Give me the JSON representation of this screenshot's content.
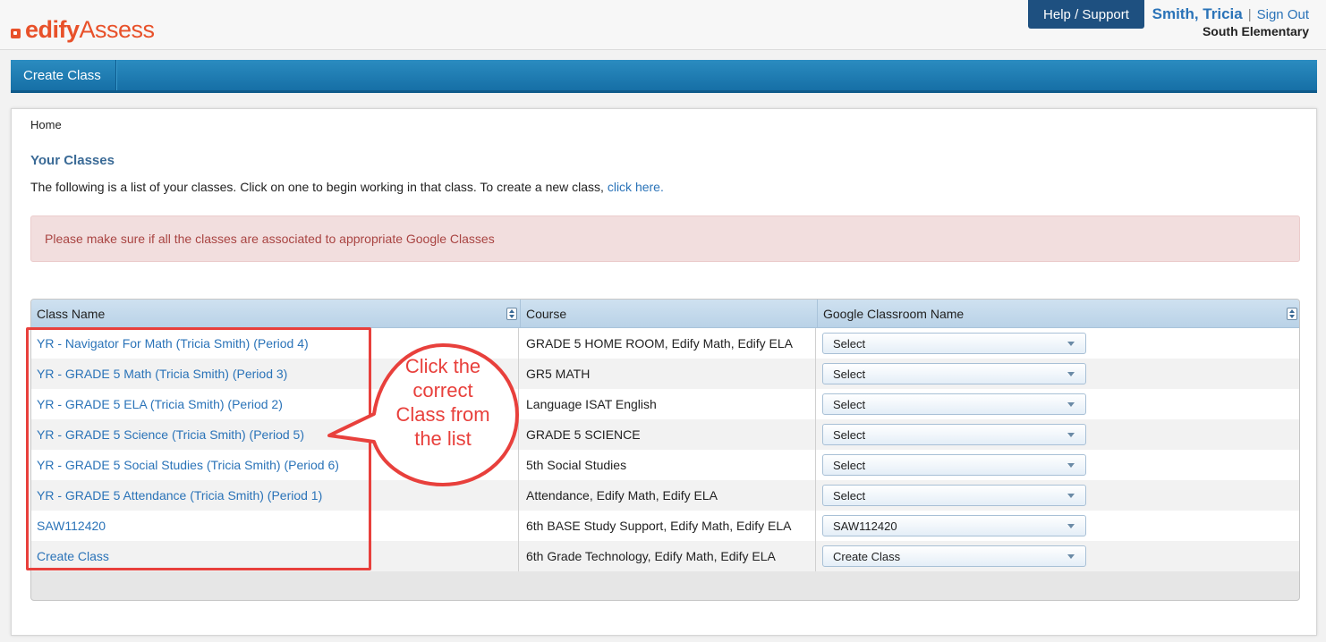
{
  "header": {
    "logo_bold": "edify",
    "logo_light": "Assess",
    "help_label": "Help / Support",
    "user_name": "Smith, Tricia",
    "separator": "|",
    "signout_label": "Sign Out",
    "school": "South Elementary"
  },
  "nav": {
    "items": [
      {
        "label": "Create Class"
      }
    ]
  },
  "main": {
    "breadcrumb": "Home",
    "title": "Your Classes",
    "intro_text": "The following is a list of your classes. Click on one to begin working in that class. To create a new class, ",
    "intro_link": "click here.",
    "alert": "Please make sure if all the classes are associated to appropriate Google Classes"
  },
  "table": {
    "columns": [
      "Class Name",
      "Course",
      "Google Classroom Name"
    ],
    "rows": [
      {
        "class_name": "YR - Navigator For Math (Tricia Smith) (Period 4)",
        "course": "GRADE 5 HOME ROOM, Edify Math, Edify ELA",
        "google": "Select"
      },
      {
        "class_name": "YR - GRADE 5 Math (Tricia Smith) (Period 3)",
        "course": "GR5 MATH",
        "google": "Select"
      },
      {
        "class_name": "YR - GRADE 5 ELA (Tricia Smith) (Period 2)",
        "course": "Language ISAT English",
        "google": "Select"
      },
      {
        "class_name": "YR - GRADE 5 Science (Tricia Smith) (Period 5)",
        "course": "GRADE 5 SCIENCE",
        "google": "Select"
      },
      {
        "class_name": "YR - GRADE 5 Social Studies (Tricia Smith) (Period 6)",
        "course": "5th Social Studies",
        "google": "Select"
      },
      {
        "class_name": "YR - GRADE 5 Attendance (Tricia Smith) (Period 1)",
        "course": "Attendance, Edify Math, Edify ELA",
        "google": "Select"
      },
      {
        "class_name": "SAW112420",
        "course": "6th BASE Study Support, Edify Math, Edify ELA",
        "google": "SAW112420"
      },
      {
        "class_name": "Create Class",
        "course": "6th Grade Technology, Edify Math, Edify ELA",
        "google": "Create Class"
      }
    ]
  },
  "annotation": {
    "line1": "Click the",
    "line2": "correct",
    "line3": "Class from",
    "line4": "the list"
  },
  "colors": {
    "accent": "#2a73b8",
    "brand": "#e8512a",
    "annotation": "#e8403c",
    "alert_bg": "#f2dede",
    "alert_text": "#a94442"
  }
}
